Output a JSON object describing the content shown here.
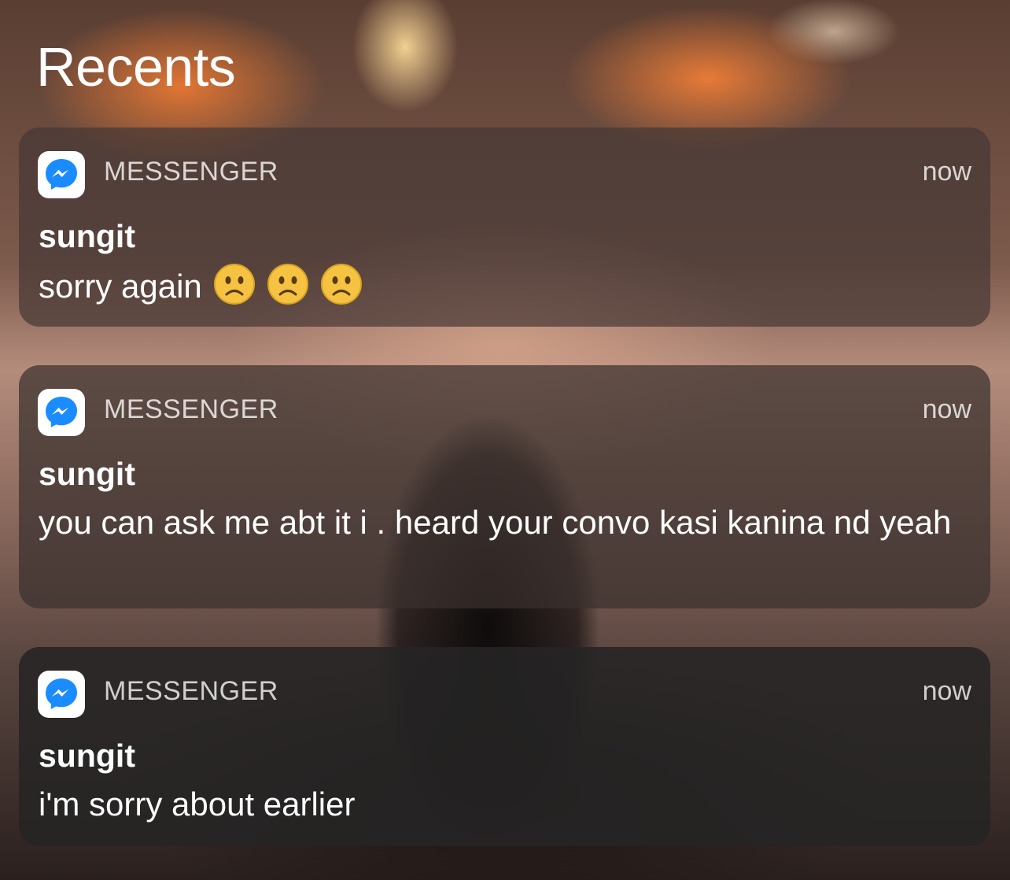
{
  "header": {
    "title": "Recents"
  },
  "notifications": [
    {
      "app_icon": "messenger-icon",
      "app_name": "MESSENGER",
      "time": "now",
      "sender": "sungit",
      "message": "sorry again",
      "emoji": [
        "slightly-frowning-face",
        "slightly-frowning-face",
        "slightly-frowning-face"
      ]
    },
    {
      "app_icon": "messenger-icon",
      "app_name": "MESSENGER",
      "time": "now",
      "sender": "sungit",
      "message": "you can ask me abt it i . heard your convo kasi kanina nd yeah"
    },
    {
      "app_icon": "messenger-icon",
      "app_name": "MESSENGER",
      "time": "now",
      "sender": "sungit",
      "message": "i'm sorry about earlier"
    }
  ],
  "colors": {
    "messenger_blue": "#1a8cff",
    "card_text": "#ffffff"
  }
}
